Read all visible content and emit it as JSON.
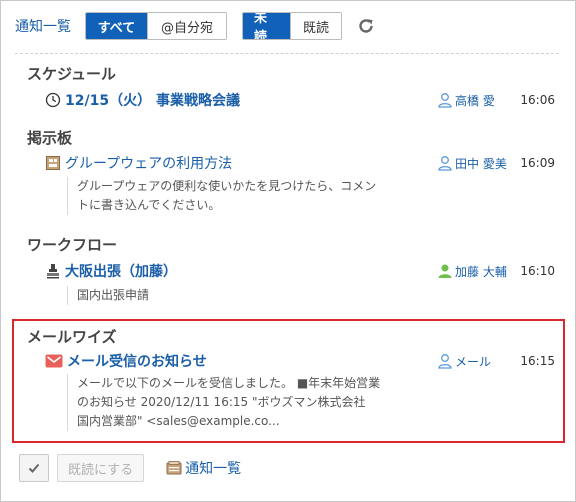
{
  "toolbar": {
    "title": "通知一覧",
    "filter_all": "すべて",
    "filter_mine": "@自分宛",
    "filter_unread": "未読",
    "filter_read": "既読"
  },
  "sections": [
    {
      "title": "スケジュール",
      "icon": "clock-icon",
      "subject": "12/15（火） 事業戦略会議",
      "user": "高橋 愛",
      "time": "16:06",
      "body": []
    },
    {
      "title": "掲示板",
      "icon": "bulletin-board-icon",
      "subject": "グループウェアの利用方法",
      "user": "田中 愛美",
      "time": "16:09",
      "body": [
        "グループウェアの便利な使いかたを見つけたら、コメン",
        "トに書き込んでください。"
      ]
    },
    {
      "title": "ワークフロー",
      "icon": "stamp-icon",
      "subject": "大阪出張（加藤）",
      "user": "加藤 大輔",
      "time": "16:10",
      "body": [
        "国内出張申請"
      ]
    },
    {
      "title": "メールワイズ",
      "icon": "mail-icon",
      "subject": "メール受信のお知らせ",
      "user": "メール",
      "time": "16:15",
      "body": [
        "メールで以下のメールを受信しました。 ■年末年始営業",
        "のお知らせ 2020/12/11 16:15 \"ボウズマン株式会社",
        "国内営業部\" <sales@example.co..."
      ]
    }
  ],
  "footer": {
    "mark_read": "既読にする",
    "list_link": "通知一覧"
  },
  "colors": {
    "accent": "#1261b8",
    "link": "#1a5fa8",
    "highlight_border": "#d9272e"
  }
}
